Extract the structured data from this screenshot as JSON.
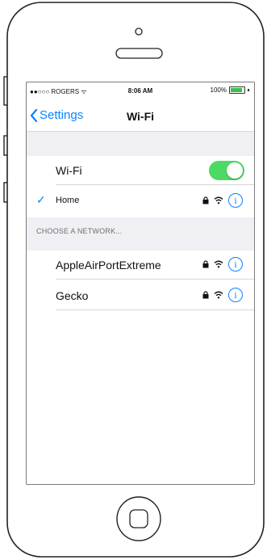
{
  "status": {
    "carrier": "●●○○○ ROGERS ᯤ",
    "time": "8:06 AM",
    "battery": "100%",
    "battery_level": 1.0
  },
  "nav": {
    "back_label": "Settings",
    "title": "Wi-Fi"
  },
  "wifi": {
    "label": "Wi-Fi",
    "enabled": true
  },
  "connected": {
    "name": "Home",
    "check": "✓",
    "secured": true,
    "icons": [
      "checkmark-icon",
      "lock-icon",
      "wifi-icon",
      "info-icon"
    ]
  },
  "section": {
    "title": "CHOOSE A NETWORK..."
  },
  "networks": [
    {
      "name": "AppleAirPortExtreme",
      "secured": true
    },
    {
      "name": "Gecko",
      "secured": true
    }
  ],
  "colors": {
    "accent": "#0a84ff",
    "toggle_on": "#4cd964",
    "group_bg": "#efeff4"
  }
}
